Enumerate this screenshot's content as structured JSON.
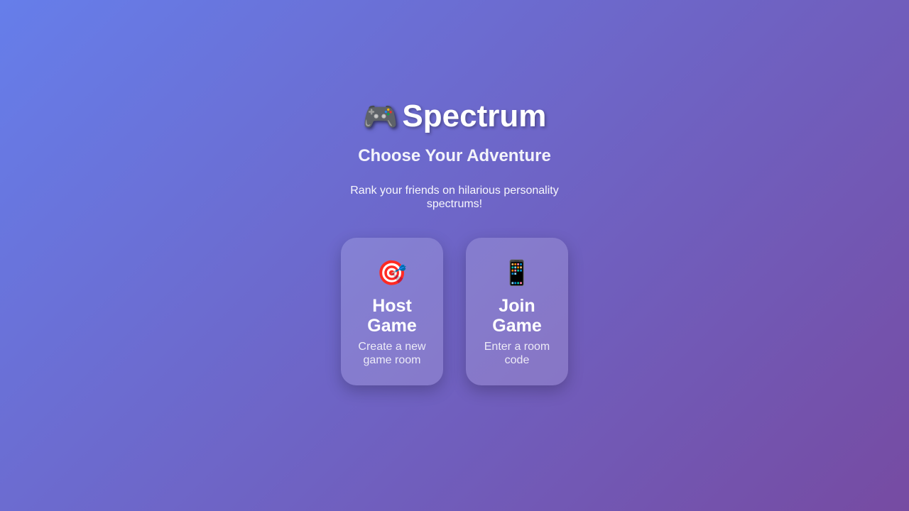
{
  "header": {
    "title_icon": "🎮",
    "title_icon_name": "game-controller-icon",
    "title": "Spectrum",
    "subtitle": "Choose Your Adventure",
    "description": "Rank your friends on hilarious personality spectrums!"
  },
  "options": [
    {
      "icon": "🎯",
      "icon_name": "dart-target-icon",
      "title": "Host Game",
      "description": "Create a new game room"
    },
    {
      "icon": "📱",
      "icon_name": "mobile-phone-icon",
      "title": "Join Game",
      "description": "Enter a room code"
    }
  ],
  "colors": {
    "gradient_start": "#667eea",
    "gradient_end": "#764ba2",
    "text": "#ffffff"
  }
}
